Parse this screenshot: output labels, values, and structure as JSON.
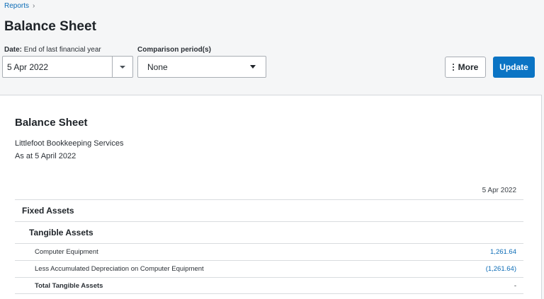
{
  "breadcrumb": {
    "link": "Reports",
    "separator": "›"
  },
  "page_title": "Balance Sheet",
  "filters": {
    "date_label_bold": "Date:",
    "date_label_text": " End of last financial year",
    "date_value": "5 Apr 2022",
    "comparison_label": "Comparison period(s)",
    "comparison_value": "None"
  },
  "actions": {
    "more_label": "More",
    "update_label": "Update"
  },
  "report": {
    "title": "Balance Sheet",
    "organisation": "Littlefoot Bookkeeping Services",
    "as_at": "As at 5 April 2022",
    "column_header": "5 Apr 2022",
    "section": "Fixed Assets",
    "subsection": "Tangible Assets",
    "rows": [
      {
        "label": "Computer Equipment",
        "amount": "1,261.64"
      },
      {
        "label": "Less Accumulated Depreciation on Computer Equipment",
        "amount": "(1,261.64)"
      }
    ],
    "total": {
      "label": "Total Tangible Assets",
      "amount": "-"
    }
  },
  "colors": {
    "accent": "#0b74c4",
    "link": "#0a6bb6"
  }
}
